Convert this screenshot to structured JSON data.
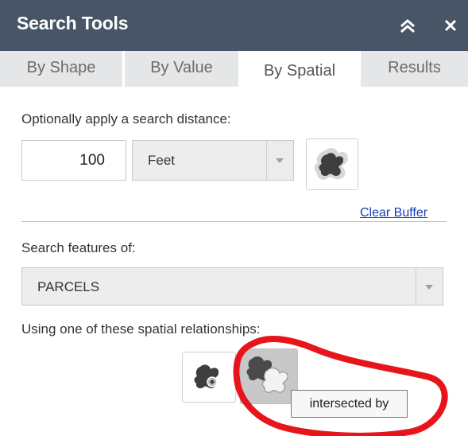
{
  "window": {
    "title": "Search Tools"
  },
  "tabs": [
    {
      "label": "By Shape",
      "active": false
    },
    {
      "label": "By Value",
      "active": false
    },
    {
      "label": "By Spatial",
      "active": true
    },
    {
      "label": "Results",
      "active": false
    }
  ],
  "spatial": {
    "distance_label": "Optionally apply a search distance:",
    "distance_value": "100",
    "units_selected": "Feet",
    "buffer_icon": "buffer-shape-icon",
    "clear_buffer_label": "Clear Buffer",
    "search_features_label": "Search features of:",
    "layer_selected": "PARCELS",
    "relationships_label": "Using one of these spatial relationships:",
    "relationships": [
      {
        "icon": "contains-shape-icon",
        "selected": false
      },
      {
        "icon": "intersected-by-shape-icon",
        "selected": true
      }
    ],
    "tooltip": "intersected by"
  },
  "colors": {
    "titlebar": "#485566",
    "tab_inactive": "#e4e6e8",
    "link": "#1a3eb8",
    "annotation": "#e8141c"
  }
}
